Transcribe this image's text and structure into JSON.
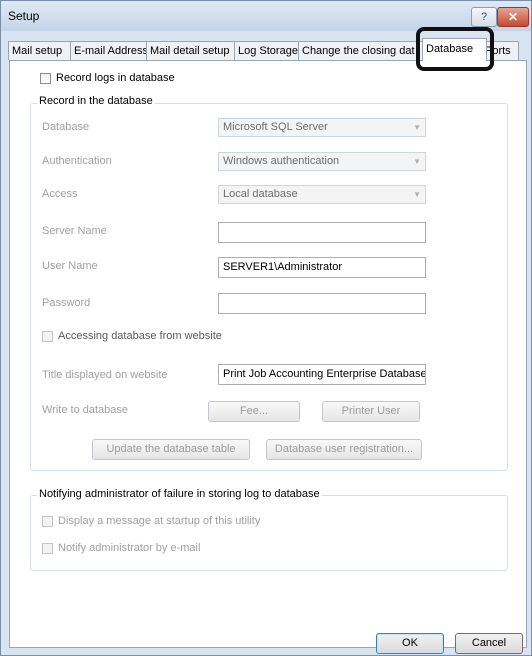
{
  "window": {
    "title": "Setup",
    "help_label": "?",
    "close_label": "✕"
  },
  "tabs": [
    {
      "label": "Mail setup"
    },
    {
      "label": "E-mail Address"
    },
    {
      "label": "Mail detail setup"
    },
    {
      "label": "Log Storage"
    },
    {
      "label": "Change the closing dat"
    },
    {
      "label": "Database"
    },
    {
      "label": "Ports"
    }
  ],
  "active_tab": "Database",
  "record_logs": {
    "label": "Record logs in database",
    "checked": false
  },
  "record_group": {
    "title": "Record in the database",
    "database": {
      "label": "Database",
      "value": "Microsoft SQL Server"
    },
    "authentication": {
      "label": "Authentication",
      "value": "Windows authentication"
    },
    "access": {
      "label": "Access",
      "value": "Local database"
    },
    "server_name": {
      "label": "Server Name",
      "value": ""
    },
    "user_name": {
      "label": "User Name",
      "value": "SERVER1\\Administrator"
    },
    "password": {
      "label": "Password",
      "value": ""
    },
    "website_access": {
      "label": "Accessing database from website",
      "checked": false
    },
    "website_title": {
      "label": "Title displayed on website",
      "value": "Print Job Accounting Enterprise Database"
    },
    "write_to_db": {
      "label": "Write to database"
    },
    "fee_button": "Fee...",
    "printer_user_button": "Printer User",
    "update_table_button": "Update the database table",
    "user_registration_button": "Database user registration..."
  },
  "notify_group": {
    "title": "Notifying administrator of failure in storing log to database",
    "display_message": {
      "label": "Display a message at startup of this utility",
      "checked": false
    },
    "notify_email": {
      "label": "Notify administrator by e-mail",
      "checked": false
    }
  },
  "footer": {
    "ok_label": "OK",
    "cancel_label": "Cancel"
  },
  "icons": {
    "dropdown": "chevron-down-icon"
  }
}
